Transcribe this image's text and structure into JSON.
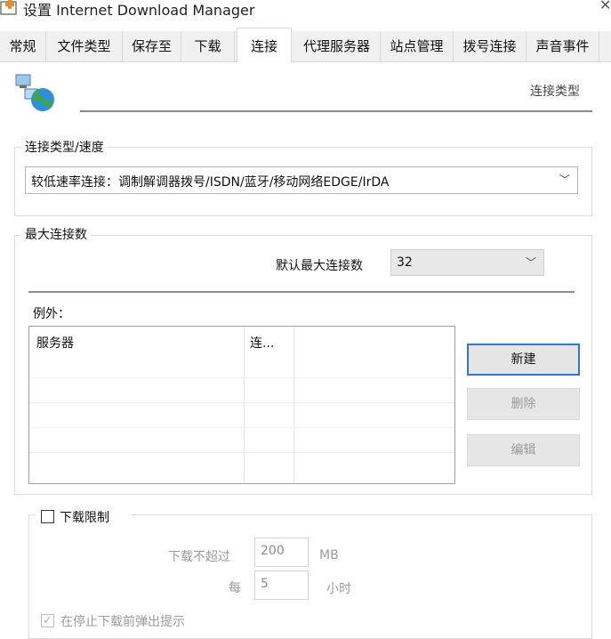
{
  "window": {
    "title": "设置 Internet Download Manager"
  },
  "tabs": [
    {
      "label": "常规"
    },
    {
      "label": "文件类型"
    },
    {
      "label": "保存至"
    },
    {
      "label": "下载"
    },
    {
      "label": "连接",
      "active": true
    },
    {
      "label": "代理服务器"
    },
    {
      "label": "站点管理"
    },
    {
      "label": "拨号连接"
    },
    {
      "label": "声音事件"
    }
  ],
  "header": {
    "label": "连接类型",
    "icon": "network-globe-icon"
  },
  "connection_speed": {
    "legend": "连接类型/速度",
    "selected": "较低速率连接：调制解调器拨号/ISDN/蓝牙/移动网络EDGE/IrDA"
  },
  "max_connections": {
    "legend": "最大连接数",
    "default_label": "默认最大连接数",
    "default_value": "32",
    "exceptions_label": "例外：",
    "columns": [
      "服务器",
      "连..."
    ],
    "buttons": {
      "new": "新建",
      "delete": "删除",
      "edit": "编辑"
    }
  },
  "download_limit": {
    "checkbox_label": "下载限制",
    "not_exceed_label": "下载不超过",
    "amount": "200",
    "amount_unit": "MB",
    "every_label": "每",
    "hours": "5",
    "hours_unit": "小时",
    "warn_label": "在停止下载前弹出提示"
  },
  "colors": {
    "accent": "#2f78d8",
    "tab_bar": "#f0f0f0"
  }
}
